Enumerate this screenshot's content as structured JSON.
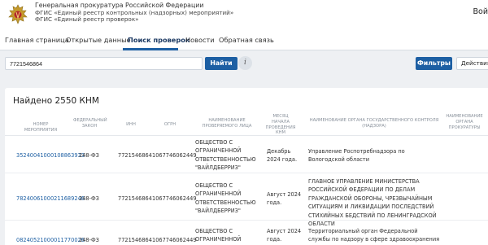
{
  "header": {
    "org_name": "Генеральная прокуратура Российской Федерации",
    "system_line1": "ФГИС «Единый реестр контрольных (надзорных) мероприятий»",
    "system_line2": "ФГИС «Единый реестр проверок»",
    "login_label": "Вой"
  },
  "nav": {
    "items": [
      {
        "label": "Главная страница"
      },
      {
        "label": "Открытые данные"
      },
      {
        "label": "Поиск проверок"
      },
      {
        "label": "Новости"
      },
      {
        "label": "Обратная связь"
      }
    ],
    "active_index": 2
  },
  "search": {
    "value": "7721546864",
    "find_label": "Найти",
    "info_icon": "i",
    "filters_label": "Фильтры",
    "actions_label": "Действия"
  },
  "results": {
    "found_text": "Найдено 2550 КНМ",
    "columns": [
      "НОМЕР МЕРОПРИЯТИЯ",
      "ФЕДЕРАЛЬНЫЙ ЗАКОН",
      "ИНН",
      "ОГРН",
      "НАИМЕНОВАНИЕ ПРОВЕРЯЕМОГО ЛИЦА",
      "МЕСЯЦ НАЧАЛА ПРОВЕДЕНИЯ КНМ",
      "НАИМЕНОВАНИЕ ОРГАНА ГОСУДАРСТВЕННОГО КОНТРОЛЯ (НАДЗОРА)",
      "НАИМЕНОВАНИЕ ОРГАНА ПРОКУРАТУРЫ"
    ],
    "rows": [
      {
        "number": "35240041000108863933",
        "law": "248-ФЗ",
        "inn": "7721546864",
        "ogrn": "1067746062449",
        "entity": "ОБЩЕСТВО С ОГРАНИЧЕННОЙ ОТВЕТСТВЕННОСТЬЮ \"ВАЙЛДБЕРРИЗ\"",
        "month": "Декабрь 2024 года.",
        "authority": "Управление Роспотребнадзора по Вологодской области",
        "prosecutor": ""
      },
      {
        "number": "78240061000211689246",
        "law": "248-ФЗ",
        "inn": "7721546864",
        "ogrn": "1067746062449",
        "entity": "ОБЩЕСТВО С ОГРАНИЧЕННОЙ ОТВЕТСТВЕННОСТЬЮ \"ВАЙЛДБЕРРИЗ\"",
        "month": "Август 2024 года.",
        "authority": "ГЛАВНОЕ УПРАВЛЕНИЕ МИНИСТЕРСТВА РОССИЙСКОЙ ФЕДЕРАЦИИ ПО ДЕЛАМ ГРАЖДАНСКОЙ ОБОРОНЫ, ЧРЕЗВЫЧАЙНЫМ СИТУАЦИЯМ И ЛИКВИДАЦИИ ПОСЛЕДСТВИЙ СТИХИЙНЫХ БЕДСТВИЙ ПО ЛЕНИНГРАДСКОЙ ОБЛАСТИ",
        "prosecutor": ""
      },
      {
        "number": "08240521000011770026",
        "law": "248-ФЗ",
        "inn": "7721546864",
        "ogrn": "1067746062449",
        "entity": "ОБЩЕСТВО С ОГРАНИЧЕННОЙ",
        "month": "Август 2024 года.",
        "authority": "Территориальный орган Федеральной службы по надзору в сфере здравоохранения по Республике",
        "prosecutor": ""
      }
    ]
  },
  "colors": {
    "accent": "#1d5fa3",
    "page_bg": "#eef0f3"
  }
}
